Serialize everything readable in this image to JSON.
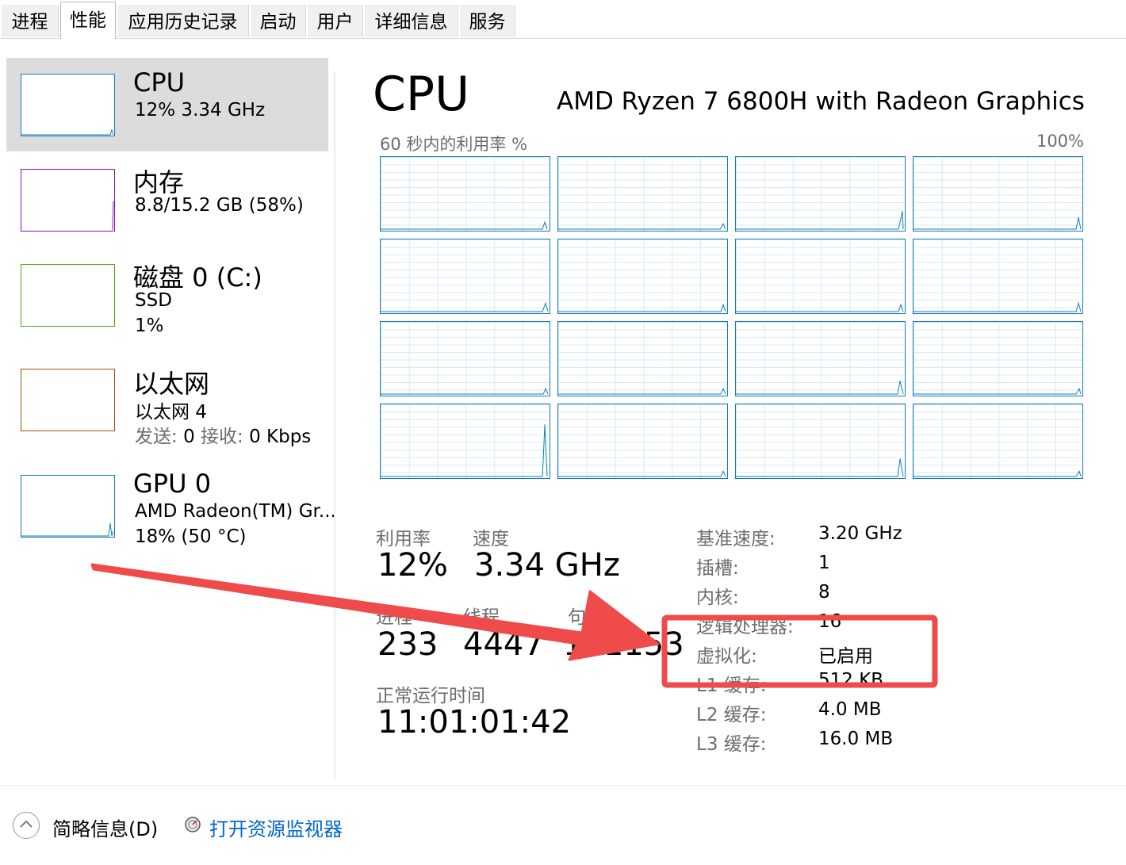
{
  "tabs": [
    "进程",
    "性能",
    "应用历史记录",
    "启动",
    "用户",
    "详细信息",
    "服务"
  ],
  "active_tab": "性能",
  "sidebar": {
    "cpu": {
      "title": "CPU",
      "sub1": "12%  3.34 GHz",
      "color": "#117dbb"
    },
    "memory": {
      "title": "内存",
      "sub1": "8.8/15.2 GB (58%)",
      "color": "#8b12ae"
    },
    "disk": {
      "title": "磁盘 0 (C:)",
      "sub1": "SSD",
      "sub2": "1%",
      "color": "#4da60c"
    },
    "ethernet": {
      "title": "以太网",
      "sub1": "以太网 4",
      "send_label": "发送:",
      "send_value": "0",
      "recv_label": "接收:",
      "recv_value": "0 Kbps",
      "color": "#a74f01"
    },
    "gpu": {
      "title": "GPU 0",
      "sub1": "AMD Radeon(TM) Gr...",
      "sub2": "18%  (50 °C)",
      "color": "#117dbb"
    }
  },
  "main": {
    "title": "CPU",
    "model": "AMD Ryzen 7 6800H with Radeon Graphics",
    "graph_label": "60 秒内的利用率 %",
    "graph_max": "100%",
    "stats": {
      "util_label": "利用率",
      "util_value": "12%",
      "speed_label": "速度",
      "speed_value": "3.34 GHz",
      "proc_label": "进程",
      "proc_value": "233",
      "thread_label": "线程",
      "thread_value": "4447",
      "handle_label": "句柄",
      "handle_value": "141153",
      "uptime_label": "正常运行时间",
      "uptime_value": "11:01:01:42"
    },
    "details": [
      {
        "label": "基准速度:",
        "value": "3.20 GHz"
      },
      {
        "label": "插槽:",
        "value": "1"
      },
      {
        "label": "内核:",
        "value": "8"
      },
      {
        "label": "逻辑处理器:",
        "value": "16"
      },
      {
        "label": "虚拟化:",
        "value": "已启用"
      },
      {
        "label": "L1 缓存:",
        "value": "512 KB"
      },
      {
        "label": "L2 缓存:",
        "value": "4.0 MB"
      },
      {
        "label": "L3 缓存:",
        "value": "16.0 MB"
      }
    ]
  },
  "footer": {
    "brief_label": "简略信息(D)",
    "monitor_label": "打开资源监视器"
  },
  "annotation": {
    "color": "#ef4b4b"
  }
}
